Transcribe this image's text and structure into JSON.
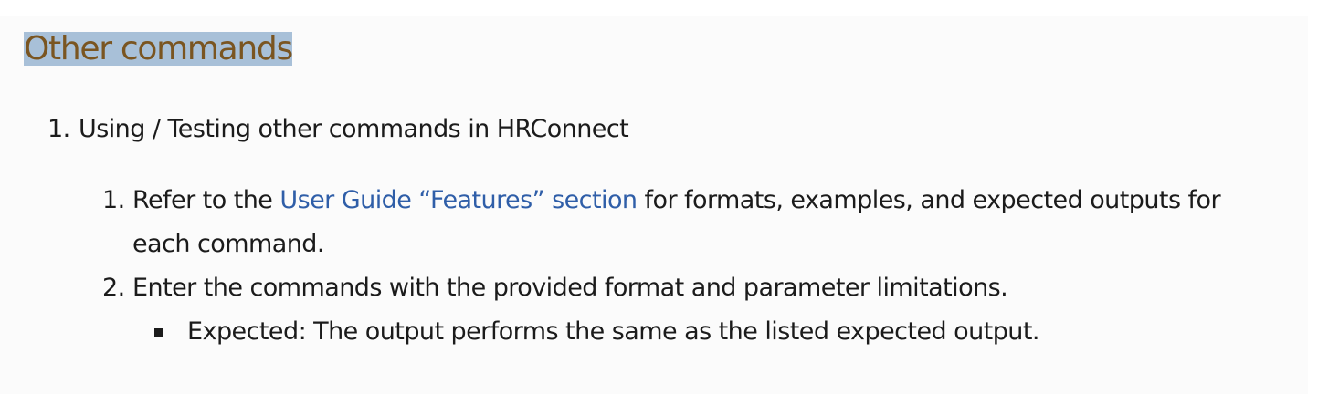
{
  "section": {
    "heading": "Other commands"
  },
  "steps": {
    "item1": {
      "number": "1.",
      "text": "Using / Testing other commands in HRConnect"
    },
    "sub1": {
      "number": "1.",
      "before": "Refer to the ",
      "link": "User Guide “Features” section",
      "after": " for formats, examples, and expected outputs for each command."
    },
    "sub2": {
      "number": "2.",
      "text": "Enter the commands with the provided format and parameter limitations.",
      "bullet": "Expected: The output performs the same as the listed expected output."
    }
  },
  "colors": {
    "heading_text": "#7a5521",
    "heading_highlight": "#a8c0d8",
    "link": "#2f5ea8",
    "body_text": "#1b1b1b",
    "background": "#fbfbfb"
  }
}
